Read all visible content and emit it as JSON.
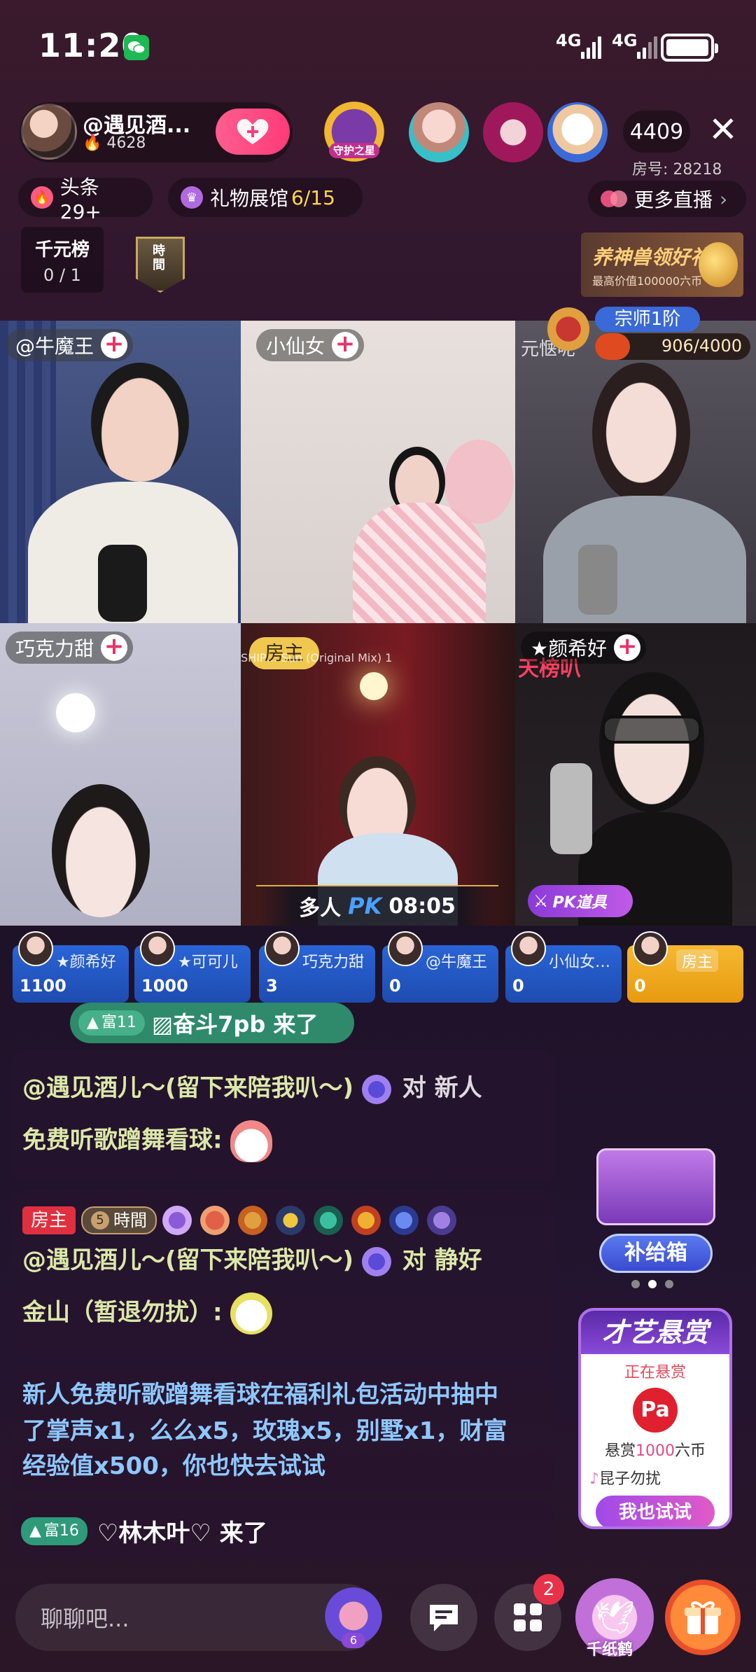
{
  "status_bar": {
    "time": "11:20",
    "signal1": "4G",
    "signal2": "4G"
  },
  "host": {
    "name": "@遇见酒...",
    "fans": "4628",
    "fans_icon": "flame-icon"
  },
  "viewer_count": "4409",
  "room_number": "房号: 28218",
  "guardian_badge": "守护之星",
  "chips": {
    "headline": "头条29+",
    "gift_hall_label": "礼物展馆",
    "gift_hall_count": "6/15",
    "more_live": "更多直播"
  },
  "rank": {
    "title": "千元榜",
    "value": "0 / 1"
  },
  "time_tag": "時間",
  "promo_banner": {
    "title": "养神兽领好礼",
    "sub": "最高价值100000六币"
  },
  "level_badge": {
    "rank": "宗师1阶",
    "progress_text": "906/4000",
    "progress": 0.2265
  },
  "video_cells": [
    {
      "name": "@牛魔王"
    },
    {
      "name": "小仙女"
    },
    {
      "name": "元惬呢"
    },
    {
      "name": "巧克力甜"
    },
    {
      "name": "房主"
    },
    {
      "name": "★颜希好"
    }
  ],
  "song_banner": "SHIP… Sun (Original Mix) 1",
  "overlay_text": "天榜叭",
  "pk_banner": {
    "label": "多人",
    "pk": "PK",
    "timer": "08:05"
  },
  "pk_tool": "PK道具",
  "scores": [
    {
      "name": "★颜希好",
      "score": "1100"
    },
    {
      "name": "★可可儿",
      "score": "1000"
    },
    {
      "name": "巧克力甜",
      "score": "3"
    },
    {
      "name": "@牛魔王",
      "score": "0"
    },
    {
      "name": "小仙女…",
      "score": "0"
    },
    {
      "name": "房主",
      "score": "0"
    }
  ],
  "chat": {
    "entry1": {
      "level": "富11",
      "text": "▨奋斗7pb 来了"
    },
    "msg1_line1": "@遇见酒儿～(留下来陪我叭～)",
    "msg1_to": "对 新人",
    "msg1_line2": "免费听歌蹭舞看球:",
    "msg2_role": "房主",
    "msg2_time_level": "5",
    "msg2_time": "時間",
    "msg2_line1": "@遇见酒儿～(留下来陪我叭～)",
    "msg2_to": "对 静好",
    "msg2_line2": "金山（暂退勿扰）:",
    "system_line1": "新人免费听歌蹭舞看球在福利礼包活动中抽中",
    "system_line2": "了掌声x1，么么x5，玫瑰x5，别墅x1，财富",
    "system_line3": "经验值x500，你也快去试试",
    "entry2": {
      "level": "富16",
      "text": "♡林木叶♡ 来了"
    }
  },
  "supply_box": "补给箱",
  "talent": {
    "title": "才艺悬赏",
    "status": "正在悬赏",
    "reward_prefix": "悬赏",
    "reward_amount": "1000",
    "reward_unit": "六币",
    "song": "昆子勿扰",
    "try_button": "我也试试"
  },
  "bottom": {
    "input_placeholder": "聊聊吧...",
    "wish_count": "6",
    "apps_badge": "2",
    "crane_label": "千纸鹤"
  },
  "colors": {
    "accent_pink": "#ff3b7a",
    "score_blue": "#2a64d6",
    "score_gold": "#f0a820",
    "entry_green": "#2e8a6a"
  }
}
